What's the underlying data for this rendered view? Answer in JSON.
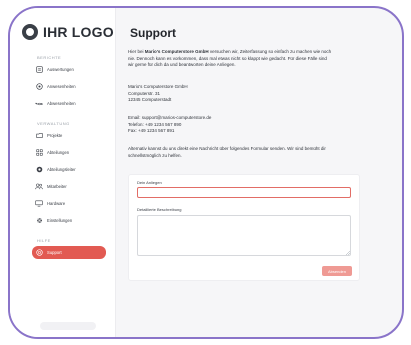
{
  "logo": {
    "text": "IHR LOGO"
  },
  "sidebar": {
    "sections": {
      "berichte": "BERICHTE",
      "verwaltung": "VERWALTUNG",
      "hilfe": "HILFE"
    },
    "items": [
      {
        "label": "Auswertungen",
        "icon": "report-icon"
      },
      {
        "label": "Anwesenheiten",
        "icon": "check-circle-icon"
      },
      {
        "label": "Abwesenheiten",
        "icon": "infinity-icon"
      },
      {
        "label": "Projekte",
        "icon": "folder-icon"
      },
      {
        "label": "Abteilungen",
        "icon": "grid-icon"
      },
      {
        "label": "Abteilungsleiter",
        "icon": "badge-icon"
      },
      {
        "label": "Mitarbeiter",
        "icon": "users-icon"
      },
      {
        "label": "Hardware",
        "icon": "monitor-icon"
      },
      {
        "label": "Einstellungen",
        "icon": "gear-icon"
      },
      {
        "label": "Support",
        "icon": "support-icon",
        "active": true
      }
    ],
    "accent_color": "#e25a52"
  },
  "main": {
    "title": "Support",
    "intro_prefix": "Hier bei ",
    "intro_brand": "Mario's Computerstore GmbH",
    "intro_line1_rest": " versuchen wir, Zeiterfassung so einfach zu machen wie noch",
    "intro_line2": "nie. Dennoch kann es vorkommen, dass mal etwas nicht so klappt wie gedacht. Für diese Fälle sind",
    "intro_line3": "wir gerne für dich da und beantworten deine Anliegen.",
    "address": {
      "name": "Mario's Computerstore GmbH",
      "street": "Computerstr. 31",
      "city": "12345 Computerstadt"
    },
    "contact": {
      "email": "Email: support@marios-computerstore.de",
      "phone": "Telefon: +49 1234 567 890",
      "fax": "Fax: +49 1234 567 891"
    },
    "alt_line1": "Alternativ kannst du uns direkt eine Nachricht über folgendes Formular senden. Wir sind bemüht dir",
    "alt_line2": "schnellstmöglich zu helfen.",
    "form": {
      "subject_label": "Dein Anliegen",
      "subject_value": "",
      "description_label": "Detaillierte Beschreibung",
      "description_value": "",
      "submit_label": "Absenden"
    }
  }
}
